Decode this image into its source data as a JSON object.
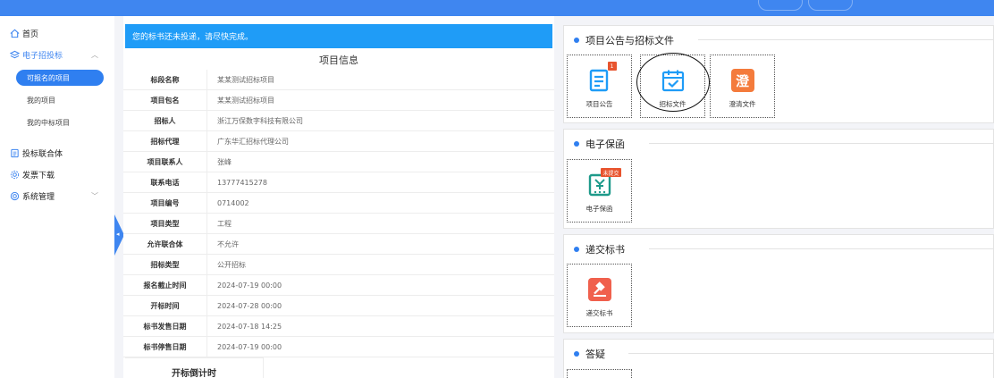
{
  "sidebar": {
    "home": "首页",
    "bidding": "电子招投标",
    "sub_items": [
      "可报名的项目",
      "我的项目",
      "我的中标项目"
    ],
    "joint_bid": "投标联合体",
    "invoice": "发票下载",
    "system": "系统管理"
  },
  "notice": "您的标书还未投递，请尽快完成。",
  "project_info": {
    "title": "项目信息",
    "rows": [
      {
        "label": "标段名称",
        "value": "某某测试招标项目"
      },
      {
        "label": "项目包名",
        "value": "某某测试招标项目"
      },
      {
        "label": "招标人",
        "value": "浙江万保数字科技有限公司"
      },
      {
        "label": "招标代理",
        "value": "广东华汇招标代理公司"
      },
      {
        "label": "项目联系人",
        "value": "张峰"
      },
      {
        "label": "联系电话",
        "value": "13777415278"
      },
      {
        "label": "项目编号",
        "value": "0714002"
      },
      {
        "label": "项目类型",
        "value": "工程"
      },
      {
        "label": "允许联合体",
        "value": "不允许"
      },
      {
        "label": "招标类型",
        "value": "公开招标"
      },
      {
        "label": "报名截止时间",
        "value": "2024-07-19 00:00"
      },
      {
        "label": "开标时间",
        "value": "2024-07-28 00:00"
      },
      {
        "label": "标书发售日期",
        "value": "2024-07-18 14:25"
      },
      {
        "label": "标书停售日期",
        "value": "2024-07-19 00:00"
      }
    ],
    "countdown": "开标倒计时"
  },
  "panels": {
    "announce": {
      "title": "项目公告与招标文件",
      "tiles": [
        {
          "label": "项目公告",
          "badge": "1"
        },
        {
          "label": "招标文件"
        },
        {
          "label": "澄清文件",
          "glyph": "澄"
        }
      ]
    },
    "guarantee": {
      "title": "电子保函",
      "tiles": [
        {
          "label": "电子保函",
          "badge": "未提交"
        }
      ]
    },
    "submit": {
      "title": "递交标书",
      "tiles": [
        {
          "label": "递交标书"
        }
      ]
    },
    "qa": {
      "title": "答疑"
    }
  },
  "colors": {
    "primary": "#3f86f0",
    "notice_bg": "#1f9cf7",
    "badge": "#e8542e",
    "orange": "#f47b3c",
    "teal": "#1e9a8a",
    "red": "#f0604d"
  }
}
